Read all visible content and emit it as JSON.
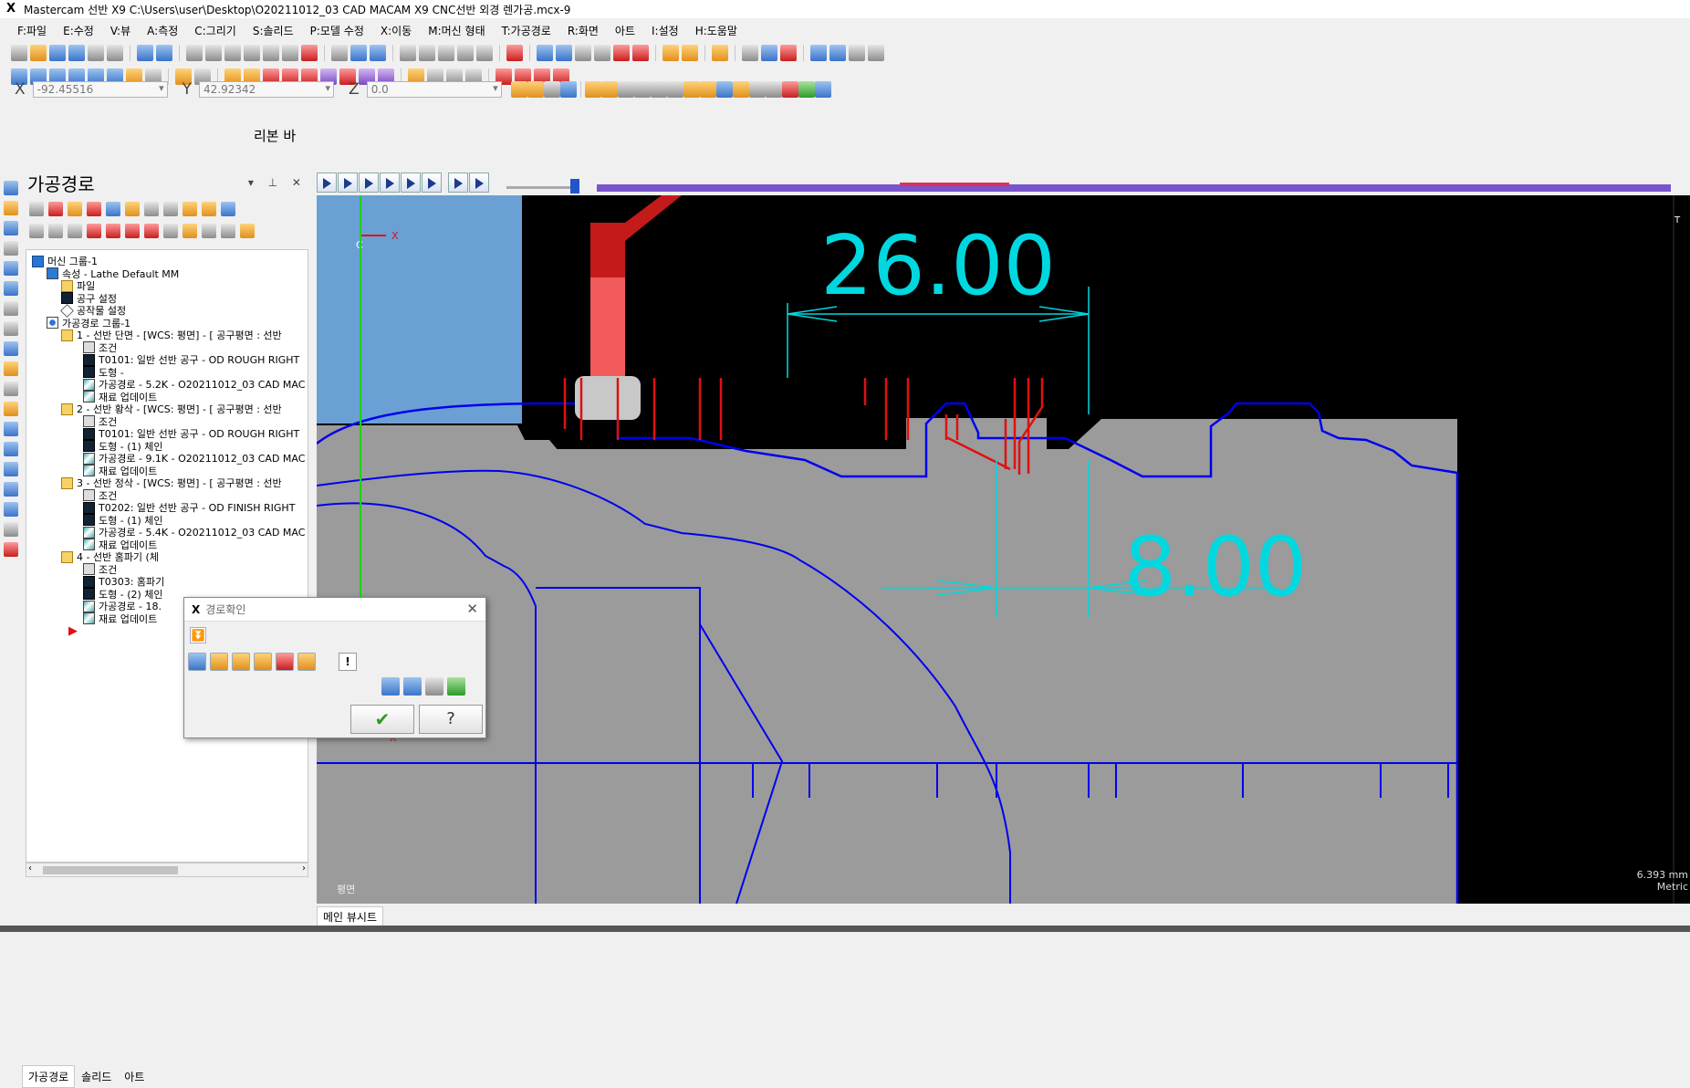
{
  "app": {
    "title": "Mastercam 선반 X9  C:\\Users\\user\\Desktop\\O20211012_03 CAD MACAM X9 CNC선반 외경 렌가공.mcx-9"
  },
  "menu": [
    "F:파일",
    "E:수정",
    "V:뷰",
    "A:측정",
    "C:그리기",
    "S:솔리드",
    "P:모델 수정",
    "X:이동",
    "M:머신 형태",
    "T:가공경로",
    "R:화면",
    "아트",
    "I:설정",
    "H:도움말"
  ],
  "coords": {
    "x_label": "X",
    "x_value": "-92.45516",
    "y_label": "Y",
    "y_value": "42.92342",
    "z_label": "Z",
    "z_value": "0.0"
  },
  "ribbon_label": "리본 바",
  "panel": {
    "title": "가공경로",
    "tabs": [
      "가공경로",
      "솔리드",
      "아트"
    ]
  },
  "tree": [
    {
      "label": "머신 그룹-1",
      "icon": "machine",
      "indent": 0
    },
    {
      "label": "속성 - Lathe Default MM",
      "icon": "props",
      "indent": 1
    },
    {
      "label": "파일",
      "icon": "folder",
      "indent": 2
    },
    {
      "label": "공구 설정",
      "icon": "tool",
      "indent": 2
    },
    {
      "label": "공작물 설정",
      "icon": "diamond",
      "indent": 2
    },
    {
      "label": "가공경로 그룹-1",
      "icon": "grp",
      "indent": 1
    },
    {
      "label": "1 - 선반 단면 - [WCS: 평면] - [ 공구평면 : 선반",
      "icon": "folder",
      "indent": 2
    },
    {
      "label": "조건",
      "icon": "cond",
      "indent": 3
    },
    {
      "label": "T0101: 일반 선반 공구 - OD ROUGH RIGHT",
      "icon": "tool",
      "indent": 3
    },
    {
      "label": "도형 -",
      "icon": "tool",
      "indent": 3
    },
    {
      "label": "가공경로 - 5.2K - O20211012_03 CAD MAC",
      "icon": "path",
      "indent": 3
    },
    {
      "label": "재료 업데이트",
      "icon": "path",
      "indent": 3
    },
    {
      "label": "2 - 선반 황삭 - [WCS: 평면] - [ 공구평면 : 선반",
      "icon": "folder",
      "indent": 2
    },
    {
      "label": "조건",
      "icon": "cond",
      "indent": 3
    },
    {
      "label": "T0101: 일반 선반 공구 - OD ROUGH RIGHT",
      "icon": "tool",
      "indent": 3
    },
    {
      "label": "도형 - (1) 체인",
      "icon": "tool",
      "indent": 3
    },
    {
      "label": "가공경로 - 9.1K - O20211012_03 CAD MAC",
      "icon": "path",
      "indent": 3
    },
    {
      "label": "재료 업데이트",
      "icon": "path",
      "indent": 3
    },
    {
      "label": "3 - 선반 정삭 - [WCS: 평면] - [ 공구평면 : 선반",
      "icon": "folder",
      "indent": 2
    },
    {
      "label": "조건",
      "icon": "cond",
      "indent": 3
    },
    {
      "label": "T0202: 일반 선반 공구 - OD FINISH RIGHT",
      "icon": "tool",
      "indent": 3
    },
    {
      "label": "도형 - (1) 체인",
      "icon": "tool",
      "indent": 3
    },
    {
      "label": "가공경로 - 5.4K - O20211012_03 CAD MAC",
      "icon": "path",
      "indent": 3
    },
    {
      "label": "재료 업데이트",
      "icon": "path",
      "indent": 3
    },
    {
      "label": "4 - 선반 홈파기 (체",
      "icon": "folder",
      "indent": 2
    },
    {
      "label": "조건",
      "icon": "cond",
      "indent": 3
    },
    {
      "label": "T0303: 홈파기",
      "icon": "tool",
      "indent": 3
    },
    {
      "label": "도형 - (2) 체인",
      "icon": "tool",
      "indent": 3
    },
    {
      "label": "가공경로 - 18.",
      "icon": "path",
      "indent": 3
    },
    {
      "label": "재료 업데이트",
      "icon": "path",
      "indent": 3
    }
  ],
  "dialog": {
    "title": "경로확인",
    "ok_symbol": "✔",
    "help_symbol": "?",
    "info_symbol": "!"
  },
  "viewport": {
    "dim_top": "26.00",
    "dim_mid": "8.00",
    "axis_x": "X",
    "axis_y": "Y",
    "axis_c": "C",
    "axis_t": "T",
    "plane_label": "평면",
    "scale_value": "6.393 mm",
    "scale_unit": "Metric",
    "colors": {
      "background": "#000000",
      "stock": "#9b9b9b",
      "toolpath": "#0000ee",
      "tool_cuts": "#e01010",
      "dimensions": "#00d8e0",
      "tool_holder": "#c41a1a"
    }
  },
  "statusbar": {
    "tab": "메인 뷰시트"
  }
}
